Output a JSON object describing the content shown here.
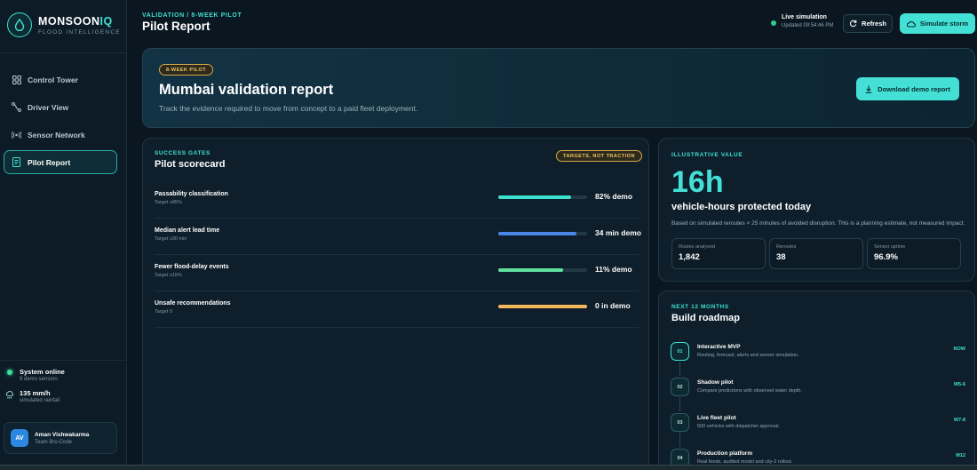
{
  "brand": {
    "name_main": "MONSOON",
    "name_accent": "IQ",
    "tagline": "FLOOD INTELLIGENCE"
  },
  "colors": {
    "accent": "#3ee0d0",
    "warning": "#f0c667",
    "background": "#0a1620",
    "online": "#3be39a"
  },
  "sidebar": {
    "items": [
      {
        "label": "Control Tower",
        "icon": "grid-icon",
        "active": false
      },
      {
        "label": "Driver View",
        "icon": "route-icon",
        "active": false
      },
      {
        "label": "Sensor Network",
        "icon": "signal-icon",
        "active": false
      },
      {
        "label": "Pilot Report",
        "icon": "report-icon",
        "active": true
      }
    ],
    "status": [
      {
        "title": "System online",
        "sub": "9 demo sensors",
        "icon": "online-dot-icon"
      },
      {
        "title": "135 mm/h",
        "sub": "simulated rainfall",
        "icon": "rain-cloud-icon"
      }
    ],
    "user": {
      "initials": "AV",
      "name": "Aman Vishwakarma",
      "team": "Team Bro-Code"
    }
  },
  "header": {
    "breadcrumb": "VALIDATION / 8-WEEK PILOT",
    "title": "Pilot Report",
    "live_title": "Live simulation",
    "live_updated": "Updated 09:54:46 PM",
    "refresh_label": "Refresh",
    "storm_label": "Simulate storm"
  },
  "hero": {
    "pill": "8-WEEK PILOT",
    "title": "Mumbai validation report",
    "subtitle": "Track the evidence required to move from concept to a paid fleet deployment.",
    "download_label": "Download demo report"
  },
  "scorecard": {
    "eyebrow": "SUCCESS GATES",
    "title": "Pilot scorecard",
    "pill": "TARGETS, NOT TRACTION",
    "metrics": [
      {
        "label": "Passability classification",
        "target": "Target ≥85%",
        "value": "82% demo",
        "progress": 0.82,
        "color": "#3ee0d0"
      },
      {
        "label": "Median alert lead time",
        "target": "Target ≥30 min",
        "value": "34 min demo",
        "progress": 0.88,
        "color": "#4a86e8"
      },
      {
        "label": "Fewer flood-delay events",
        "target": "Target ≥15%",
        "value": "11% demo",
        "progress": 0.73,
        "color": "#5fe0a0"
      },
      {
        "label": "Unsafe recommendations",
        "target": "Target 0",
        "value": "0 in demo",
        "progress": 1.0,
        "color": "#f0b85a"
      }
    ]
  },
  "value_card": {
    "eyebrow": "ILLUSTRATIVE VALUE",
    "big_number": "16h",
    "big_label": "vehicle-hours protected today",
    "note": "Based on simulated reroutes × 25 minutes of avoided disruption. This is a planning estimate, not measured impact.",
    "stats": [
      {
        "label": "Routes analyzed",
        "value": "1,842"
      },
      {
        "label": "Reroutes",
        "value": "38"
      },
      {
        "label": "Sensor uptime",
        "value": "96.9%"
      }
    ]
  },
  "roadmap": {
    "eyebrow": "NEXT 12 MONTHS",
    "title": "Build roadmap",
    "steps": [
      {
        "num": "01",
        "title": "Interactive MVP",
        "desc": "Routing, forecast, alerts and sensor simulation.",
        "tag": "NOW"
      },
      {
        "num": "02",
        "title": "Shadow pilot",
        "desc": "Compare predictions with observed water depth.",
        "tag": "W5-6"
      },
      {
        "num": "03",
        "title": "Live fleet pilot",
        "desc": "500 vehicles with dispatcher approval.",
        "tag": "W7-8"
      },
      {
        "num": "04",
        "title": "Production platform",
        "desc": "Real feeds, audited model and city-2 rollout.",
        "tag": "M12"
      }
    ]
  }
}
